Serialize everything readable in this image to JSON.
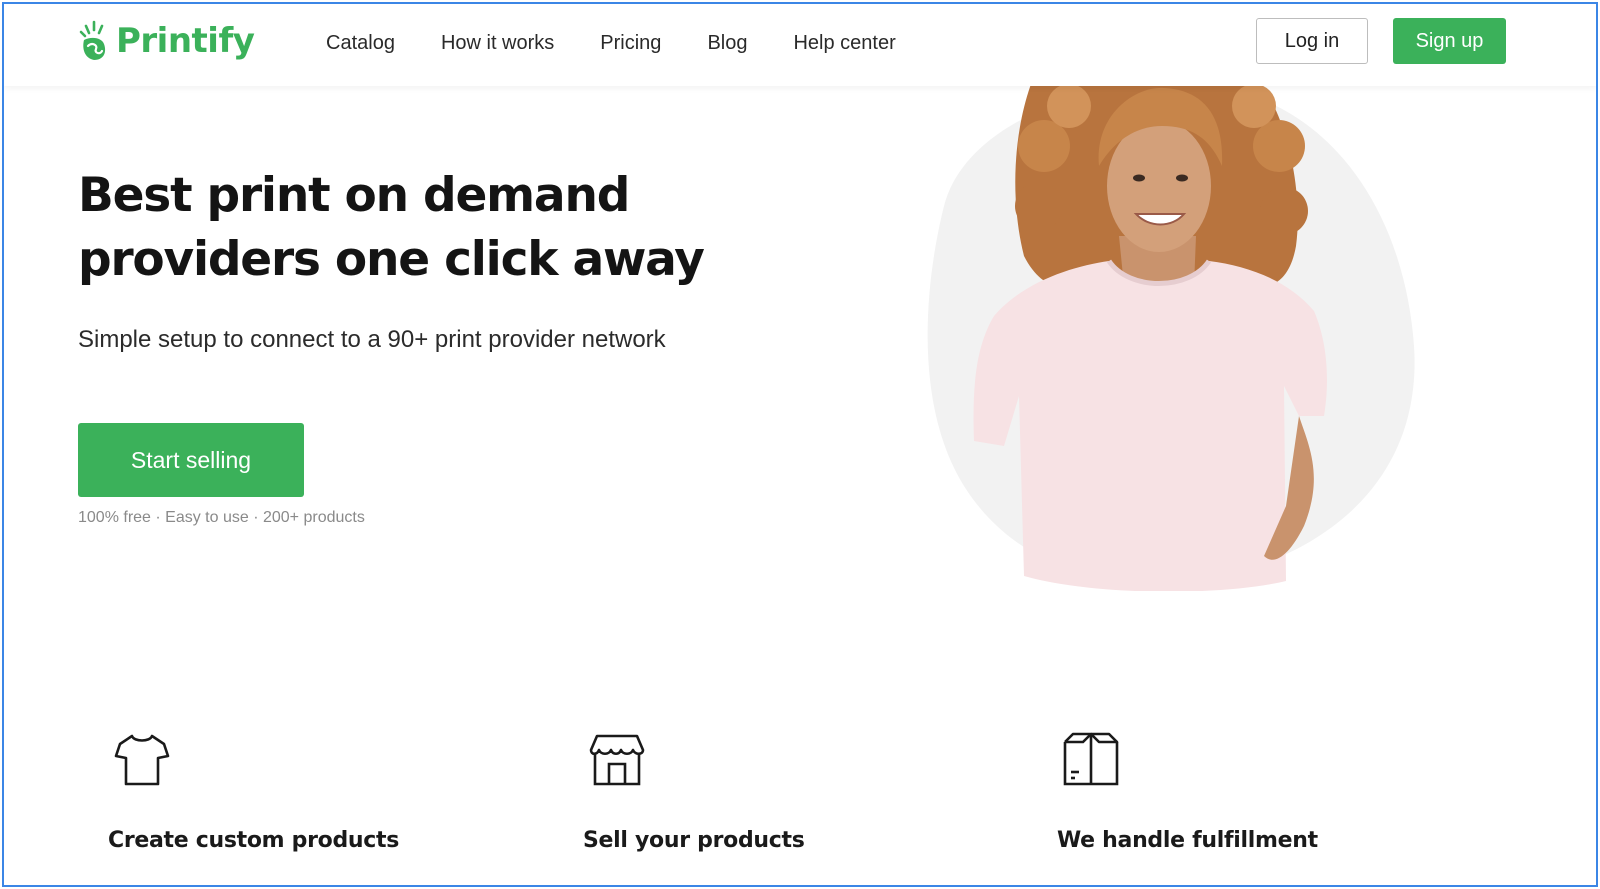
{
  "header": {
    "brand": "Printify",
    "nav": [
      "Catalog",
      "How it works",
      "Pricing",
      "Blog",
      "Help center"
    ],
    "login_label": "Log in",
    "signup_label": "Sign up"
  },
  "hero": {
    "title_line1": "Best print on demand",
    "title_line2": "providers one click away",
    "subtitle": "Simple setup to connect to a 90+ print provider network",
    "cta_label": "Start selling",
    "features_note": "100% free · Easy to use  · 200+ products"
  },
  "features": [
    {
      "icon": "tshirt-icon",
      "title": "Create custom products"
    },
    {
      "icon": "storefront-icon",
      "title": "Sell your products"
    },
    {
      "icon": "box-icon",
      "title": "We handle fulfillment"
    }
  ],
  "colors": {
    "brand_green": "#3bb15a",
    "text_dark": "#141414",
    "muted": "#8a8a8a"
  }
}
